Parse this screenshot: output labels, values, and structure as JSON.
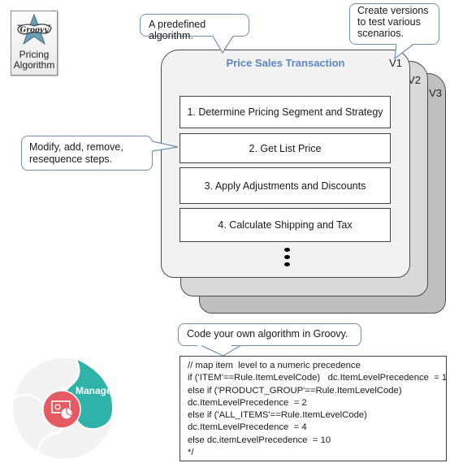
{
  "icon": {
    "name": "groovy-logo",
    "label_line1": "Pricing",
    "label_line2": "Algorithm"
  },
  "callouts": {
    "predefined": "A predefined  algorithm.",
    "versions": [
      "Create versions",
      "to test various",
      "scenarios."
    ],
    "modify": [
      "Modify, add, remove,",
      "resequence  steps."
    ],
    "groovy": "Code your own algorithm in Groovy."
  },
  "algorithm": {
    "title": "Price Sales Transaction",
    "versions": [
      "V1",
      "V2",
      "V3"
    ],
    "steps": [
      "1. Determine Pricing Segment and Strategy",
      "2. Get List Price",
      "3. Apply Adjustments and Discounts",
      "4. Calculate Shipping and Tax"
    ],
    "more_indicator": "vertical-ellipsis"
  },
  "code": {
    "lines": [
      "// map item  level to a numeric precedence",
      "if ('ITEM'==Rule.ItemLevelCode)   dc.ItemLevelPrecedence  = 1",
      "else if ('PRODUCT_GROUP'==Rule.ItemLevelCode)",
      "dc.ItemLevelPrecedence  = 2",
      "else if ('ALL_ITEMS'==Rule.ItemLevelCode)",
      "dc.ItemLevelPrecedence  = 4",
      "else dc.itemLevelPrecedence  = 10",
      "*/"
    ]
  },
  "manage": {
    "label": "Manage",
    "icon": "pricing-money-chart-icon",
    "colors": {
      "teal": "#2fb3a9",
      "red": "#e55a63",
      "ring": "#f2f2f2"
    }
  },
  "colors": {
    "title_blue": "#5d86c4",
    "callout_border": "#6f8fb0",
    "v1_fill": "#f2f2f2",
    "v2_fill": "#d9d9d9",
    "v3_fill": "#bfbfbf"
  }
}
